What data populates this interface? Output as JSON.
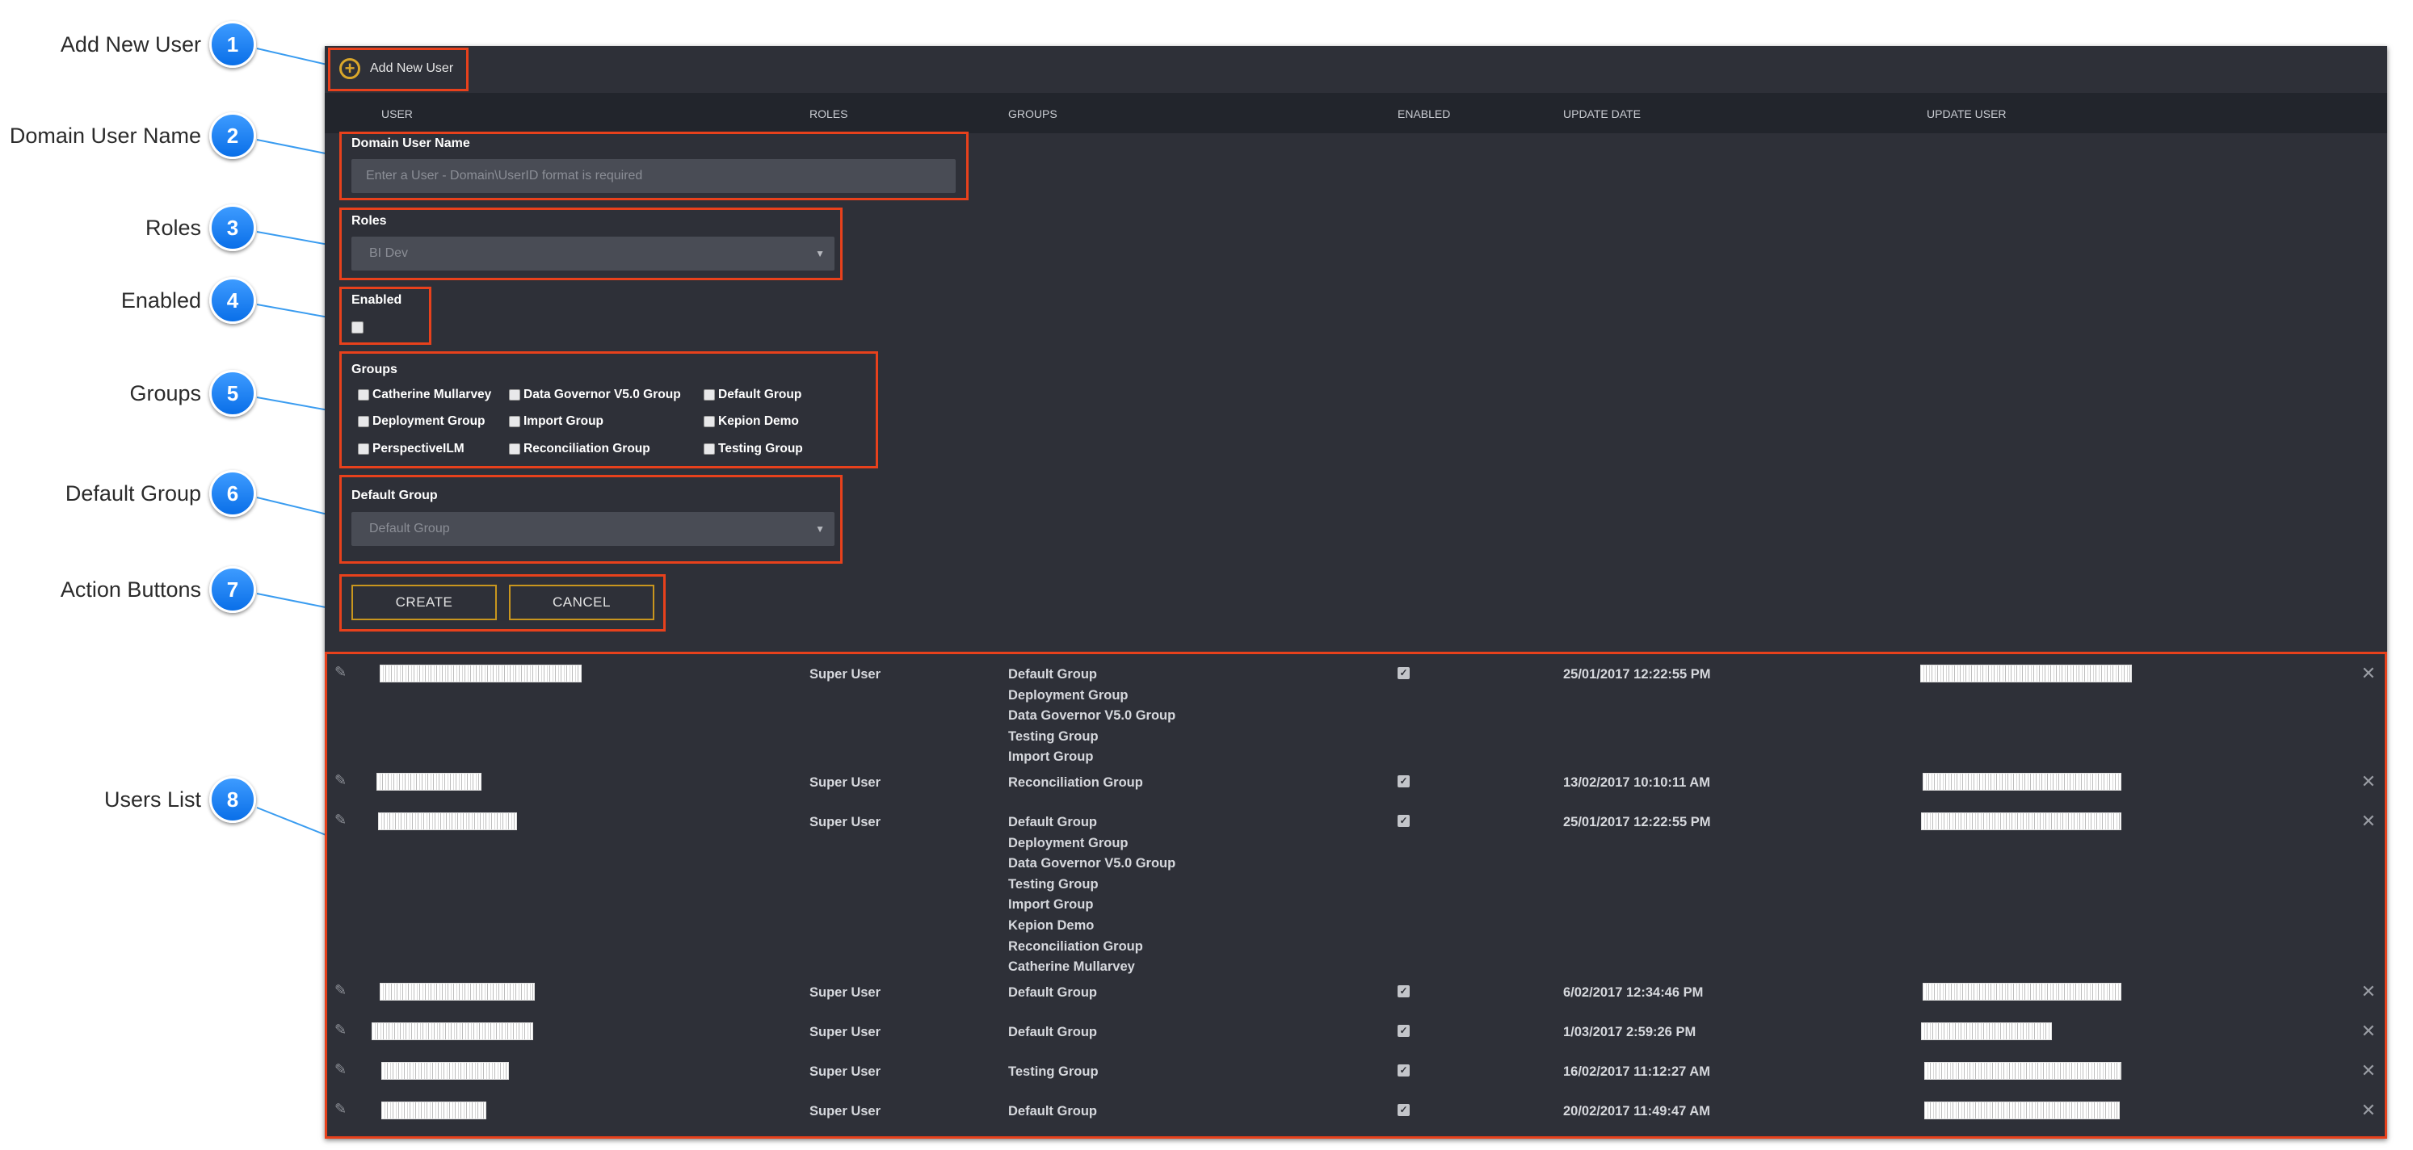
{
  "callouts": [
    {
      "number": "1",
      "label": "Add New User"
    },
    {
      "number": "2",
      "label": "Domain User Name"
    },
    {
      "number": "3",
      "label": "Roles"
    },
    {
      "number": "4",
      "label": "Enabled"
    },
    {
      "number": "5",
      "label": "Groups"
    },
    {
      "number": "6",
      "label": "Default Group"
    },
    {
      "number": "7",
      "label": "Action Buttons"
    },
    {
      "number": "8",
      "label": "Users List"
    }
  ],
  "toolbar": {
    "add_user_label": "Add New User"
  },
  "table": {
    "columns": [
      "USER",
      "ROLES",
      "GROUPS",
      "ENABLED",
      "UPDATE DATE",
      "UPDATE USER"
    ]
  },
  "form": {
    "domain_user_label": "Domain User Name",
    "domain_user_placeholder": "Enter a User - Domain\\UserID format is required",
    "roles_label": "Roles",
    "roles_value": "BI Dev",
    "enabled_label": "Enabled",
    "enabled_checked": false,
    "groups_label": "Groups",
    "groups": [
      "Catherine Mullarvey",
      "Data Governor V5.0 Group",
      "Default Group",
      "Deployment Group",
      "Import Group",
      "Kepion Demo",
      "PerspectiveILM",
      "Reconciliation Group",
      "Testing Group"
    ],
    "default_group_label": "Default Group",
    "default_group_value": "Default Group",
    "create_label": "CREATE",
    "cancel_label": "CANCEL"
  },
  "users": [
    {
      "role": "Super User",
      "groups": [
        "Default Group",
        "Deployment Group",
        "Data Governor V5.0 Group",
        "Testing Group",
        "Import Group"
      ],
      "enabled": true,
      "update_date": "25/01/2017 12:22:55 PM"
    },
    {
      "role": "Super User",
      "groups": [
        "Reconciliation Group"
      ],
      "enabled": true,
      "update_date": "13/02/2017 10:10:11 AM"
    },
    {
      "role": "Super User",
      "groups": [
        "Default Group",
        "Deployment Group",
        "Data Governor V5.0 Group",
        "Testing Group",
        "Import Group",
        "Kepion Demo",
        "Reconciliation Group",
        "Catherine Mullarvey"
      ],
      "enabled": true,
      "update_date": "25/01/2017 12:22:55 PM"
    },
    {
      "role": "Super User",
      "groups": [
        "Default Group"
      ],
      "enabled": true,
      "update_date": "6/02/2017 12:34:46 PM"
    },
    {
      "role": "Super User",
      "groups": [
        "Default Group"
      ],
      "enabled": true,
      "update_date": "1/03/2017 2:59:26 PM"
    },
    {
      "role": "Super User",
      "groups": [
        "Testing Group"
      ],
      "enabled": true,
      "update_date": "16/02/2017 11:12:27 AM"
    },
    {
      "role": "Super User",
      "groups": [
        "Default Group"
      ],
      "enabled": true,
      "update_date": "20/02/2017 11:49:47 AM"
    }
  ],
  "colors": {
    "highlight": "#e8411c",
    "badge": "#0a6fe8",
    "panel": "#2e3038",
    "button_border": "#c9961e"
  }
}
